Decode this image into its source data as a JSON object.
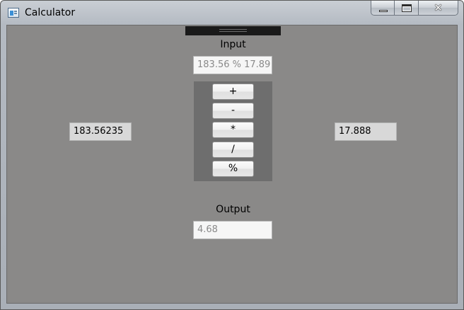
{
  "window": {
    "title": "Calculator",
    "close_glyph": "✕"
  },
  "input": {
    "label": "Input",
    "value": "183.56 % 17.89"
  },
  "operand_left": {
    "value": "183.56235"
  },
  "operand_right": {
    "value": "17.888"
  },
  "operators": [
    {
      "label": "+"
    },
    {
      "label": "-"
    },
    {
      "label": "*"
    },
    {
      "label": "/"
    },
    {
      "label": "%"
    }
  ],
  "output": {
    "label": "Output",
    "value": "4.68"
  },
  "icons": {
    "app": "calculator-app-icon",
    "minimize": "minimize-icon",
    "maximize": "maximize-icon",
    "close": "close-icon"
  }
}
